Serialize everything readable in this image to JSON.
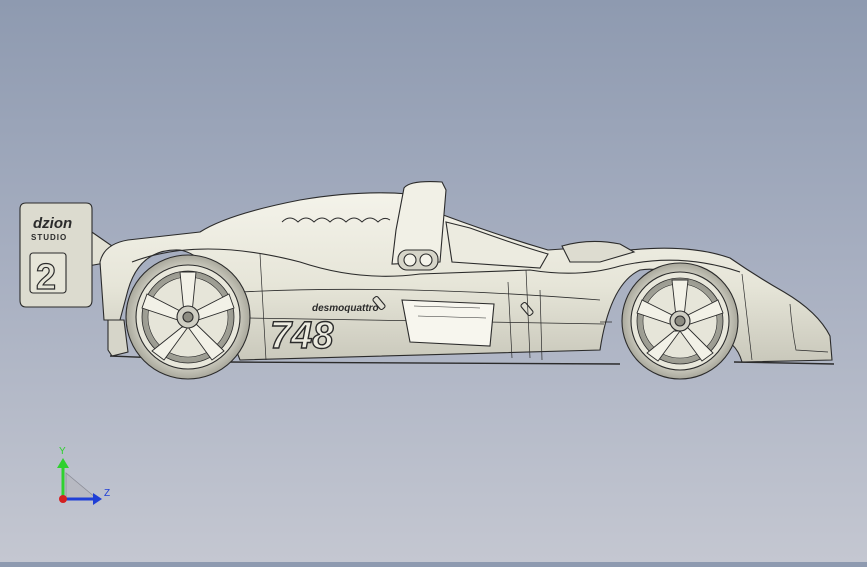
{
  "model": {
    "wing_logo_line1": "dzion",
    "wing_logo_line2": "STUDIO",
    "wing_number": "2",
    "race_number": "748",
    "sponsor_text": "desmoquattro"
  },
  "triad": {
    "y_label": "Y",
    "z_label": "Z",
    "y_color": "#2fd12f",
    "z_color": "#1f3fd6",
    "x_color": "#d42020"
  },
  "colors": {
    "bg_top": "#8e9ab0",
    "bg_bottom": "#c4c7d1",
    "body_fill": "#e9e8dc",
    "edge": "#2b2b2b"
  }
}
